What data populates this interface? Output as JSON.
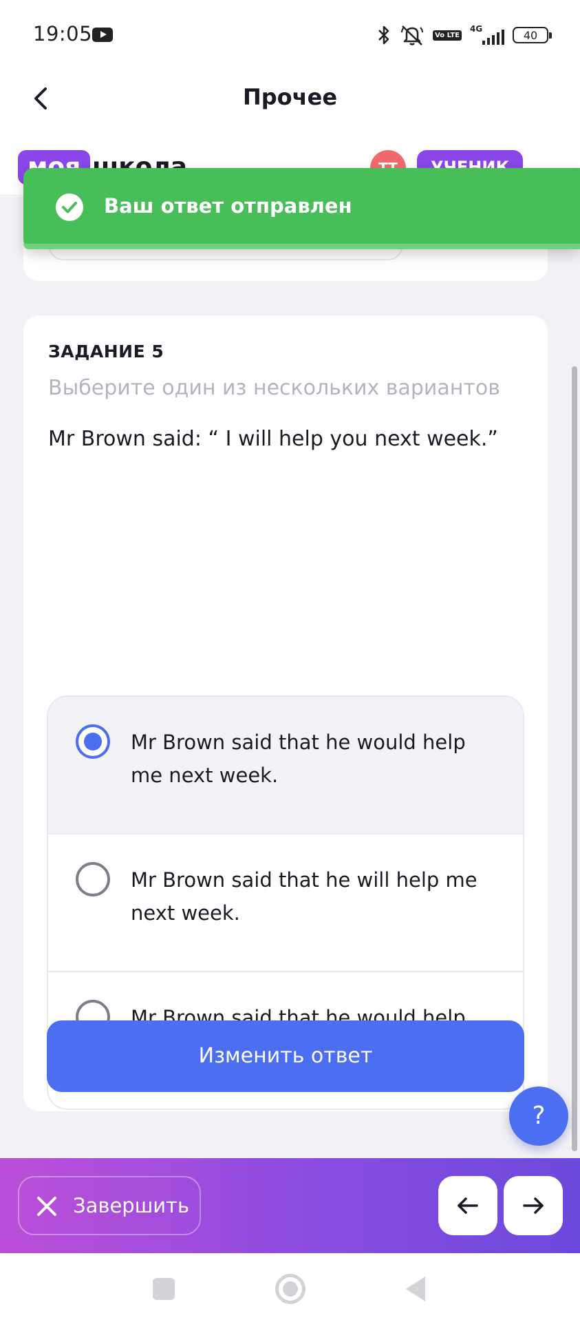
{
  "status_bar": {
    "time": "19:05",
    "network": "4G",
    "volte": "Vo LTE",
    "battery": "40"
  },
  "header": {
    "title": "Прочее"
  },
  "app_bar": {
    "logo_part1": "моя",
    "logo_part2": "школа",
    "avatar_initials": "TT",
    "role": "УЧЕНИК"
  },
  "toast": {
    "message": "Ваш ответ отправлен"
  },
  "task": {
    "number_label": "ЗАДАНИЕ 5",
    "instruction": "Выберите один из нескольких вариантов",
    "question": "Mr Brown said: “ I will help you next week.”",
    "options": [
      {
        "label": "Mr Brown said that he would help me next week.",
        "selected": true
      },
      {
        "label": "Mr Brown said that he will help me next week.",
        "selected": false
      },
      {
        "label": "Mr Brown said that he would help me the following week",
        "selected": false
      }
    ],
    "change_answer_label": "Изменить ответ"
  },
  "help_button": {
    "label": "?"
  },
  "bottom_bar": {
    "finish_label": "Завершить"
  },
  "colors": {
    "accent": "#4b6ff0",
    "toast_green": "#47be58",
    "brand_purple": "#8a46e8",
    "gradient_start": "#bc4ed8",
    "gradient_end": "#6b49dc"
  },
  "icons": {
    "back": "chevron-left-icon",
    "toast": "check-circle-icon",
    "finish": "close-icon",
    "prev": "arrow-left-icon",
    "next": "arrow-right-icon"
  }
}
